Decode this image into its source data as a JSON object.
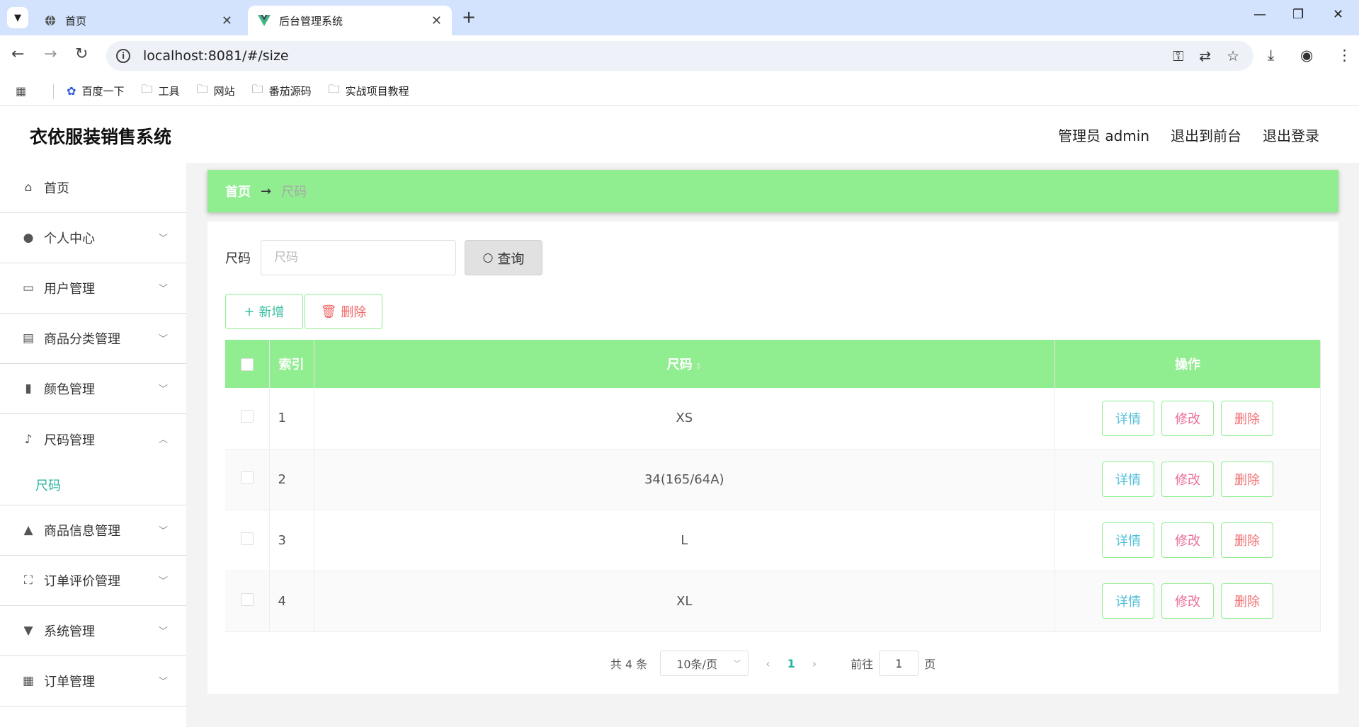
{
  "browser": {
    "tabs": [
      {
        "title": "首页",
        "icon": "globe-icon"
      },
      {
        "title": "后台管理系统",
        "icon": "vue-logo-icon"
      }
    ],
    "url": "localhost:8081/#/size",
    "bookmarks": [
      {
        "label": "百度一下",
        "icon": "baidu-paw-icon"
      },
      {
        "label": "工具",
        "icon": "folder-icon"
      },
      {
        "label": "网站",
        "icon": "folder-icon"
      },
      {
        "label": "番茄源码",
        "icon": "folder-icon"
      },
      {
        "label": "实战项目教程",
        "icon": "folder-icon"
      }
    ]
  },
  "header": {
    "title": "衣依服装销售系统",
    "user": "管理员 admin",
    "to_front": "退出到前台",
    "logout": "退出登录"
  },
  "sidebar": {
    "items": [
      {
        "label": "首页",
        "icon": "home-icon"
      },
      {
        "label": "个人中心",
        "icon": "user-icon"
      },
      {
        "label": "用户管理",
        "icon": "chat-icon"
      },
      {
        "label": "商品分类管理",
        "icon": "clipboard-icon"
      },
      {
        "label": "颜色管理",
        "icon": "book-icon"
      },
      {
        "label": "尺码管理",
        "icon": "microphone-icon"
      },
      {
        "label": "尺码"
      },
      {
        "label": "商品信息管理",
        "icon": "person-badge-icon"
      },
      {
        "label": "订单评价管理",
        "icon": "crop-icon"
      },
      {
        "label": "系统管理",
        "icon": "brush-icon"
      },
      {
        "label": "订单管理",
        "icon": "grid-icon"
      }
    ]
  },
  "breadcrumb": {
    "home": "首页",
    "current": "尺码"
  },
  "search": {
    "label": "尺码",
    "placeholder": "尺码",
    "button": "查询"
  },
  "actions": {
    "add": "新增",
    "delete": "删除"
  },
  "table": {
    "headers": {
      "index": "索引",
      "size": "尺码",
      "ops": "操作"
    },
    "rows": [
      {
        "index": "1",
        "size": "XS"
      },
      {
        "index": "2",
        "size": "34(165/64A)"
      },
      {
        "index": "3",
        "size": "L"
      },
      {
        "index": "4",
        "size": "XL"
      }
    ],
    "op_labels": {
      "detail": "详情",
      "edit": "修改",
      "delete": "删除"
    }
  },
  "pagination": {
    "total": "共 4 条",
    "page_size": "10条/页",
    "current": "1",
    "goto": "前往",
    "goto_value": "1",
    "page_unit": "页"
  },
  "colors": {
    "accent_green": "#90ee90",
    "link_teal": "#2bb5a0"
  }
}
